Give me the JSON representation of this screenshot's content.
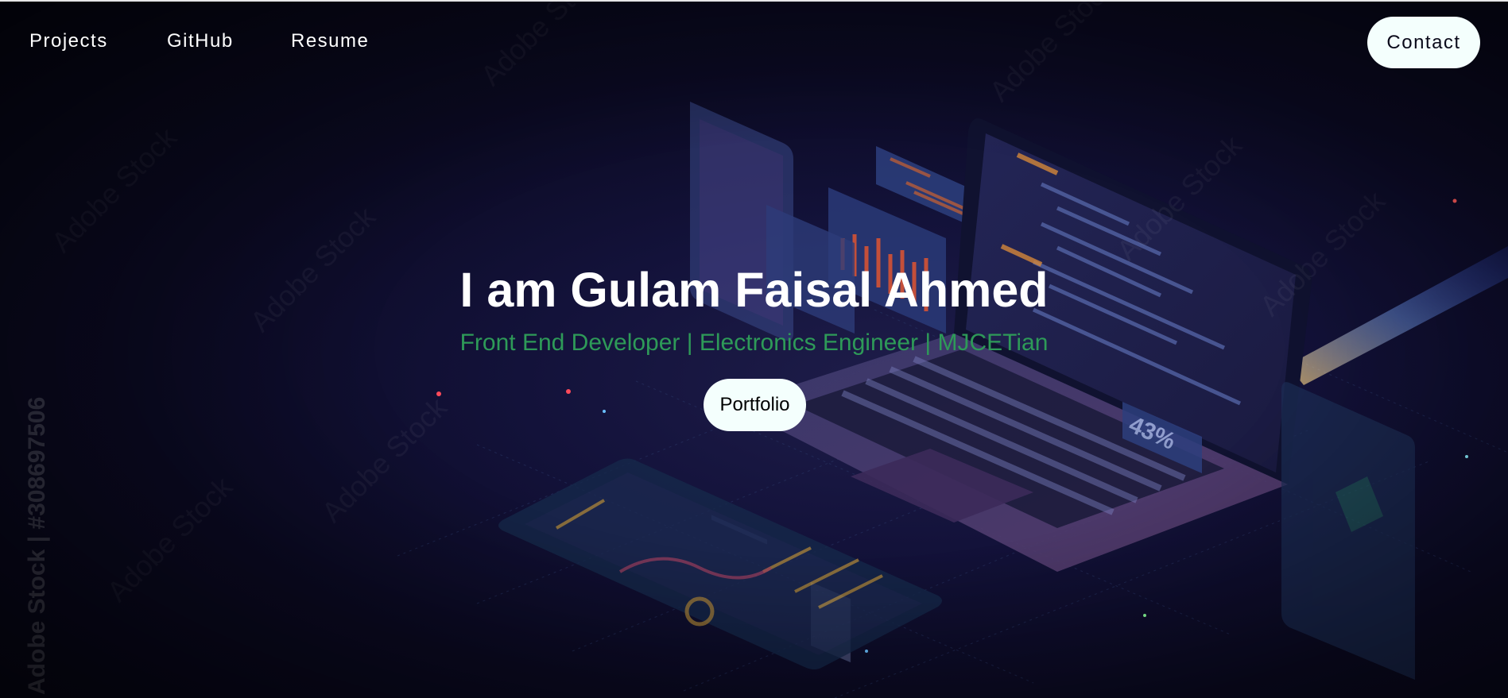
{
  "nav": {
    "links": [
      {
        "label": "Projects"
      },
      {
        "label": "GitHub"
      },
      {
        "label": "Resume"
      }
    ],
    "contact_label": "Contact"
  },
  "hero": {
    "title": "I am Gulam Faisal Ahmed",
    "subtitle": "Front End Developer | Electronics Engineer | MJCETian",
    "portfolio_label": "Portfolio",
    "background": {
      "laptop_screen_badge": "43%",
      "watermark_text": "Adobe Stock",
      "watermark_id": "Adobe Stock | #308697506"
    }
  },
  "colors": {
    "background": "#0b0a22",
    "title": "#ffffff",
    "subtitle": "#2e9a58",
    "button_bg": "#f4fffd",
    "button_text": "#0a0a1a"
  }
}
